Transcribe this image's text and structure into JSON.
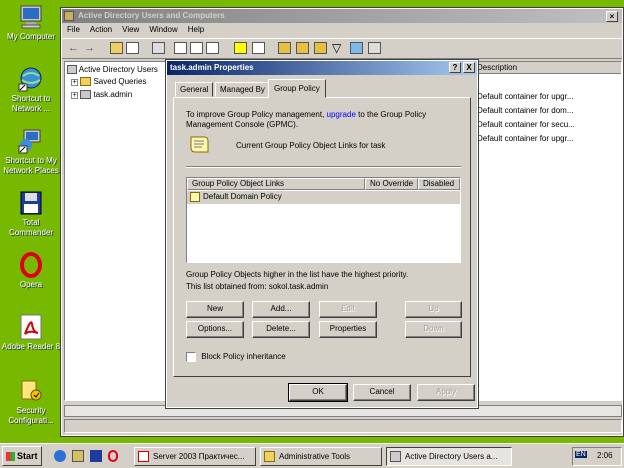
{
  "desktop": {
    "icons": [
      {
        "label": "My Computer"
      },
      {
        "label": "Shortcut to Network ..."
      },
      {
        "label": "Shortcut to My Network Places"
      },
      {
        "label": "Total Commander"
      },
      {
        "label": "Opera"
      },
      {
        "label": "Adobe Reader 8"
      },
      {
        "label": "Security Configurati..."
      }
    ]
  },
  "main_window": {
    "title": "Active Directory Users and Computers",
    "menu": [
      "File",
      "Action",
      "View",
      "Window",
      "Help"
    ],
    "tree": {
      "root": "Active Directory Users",
      "children": [
        "Saved Queries",
        "task.admin"
      ]
    },
    "list": {
      "column": "Description",
      "rows": [
        "Default container for upgr...",
        "Default container for dom...",
        "Default container for secu...",
        "Default container for upgr..."
      ]
    }
  },
  "dialog": {
    "title": "task.admin Properties",
    "help_btn": "?",
    "close_btn": "X",
    "tabs": [
      "General",
      "Managed By",
      "Group Policy"
    ],
    "active_tab": "Group Policy",
    "info_pre": "To improve Group Policy management,",
    "info_link": "upgrade",
    "info_post": "to the Group Policy Management Console (GPMC).",
    "current_links": "Current Group Policy Object Links for task",
    "table": {
      "headers": [
        "Group Policy Object Links",
        "No Override",
        "Disabled"
      ],
      "rows": [
        [
          "Default Domain Policy",
          "",
          ""
        ]
      ]
    },
    "note1": "Group Policy Objects higher in the list have the highest priority.",
    "note2": "This list obtained from: sokol.task.admin",
    "buttons": {
      "new": "New",
      "add": "Add...",
      "edit": "Edit",
      "up": "Up",
      "options": "Options...",
      "delete": "Delete...",
      "properties": "Properties",
      "down": "Down"
    },
    "block_inheritance": "Block Policy inheritance",
    "ok": "OK",
    "cancel": "Cancel",
    "apply": "Apply"
  },
  "taskbar": {
    "start": "Start",
    "tasks": [
      "Server 2003 Практичес...",
      "Administrative Tools",
      "Active Directory Users a..."
    ],
    "lang": "EN",
    "clock": "2:06"
  },
  "colors": {
    "desktop": "#76b900",
    "title_active": "#0a246a",
    "link": "#0000ff"
  }
}
